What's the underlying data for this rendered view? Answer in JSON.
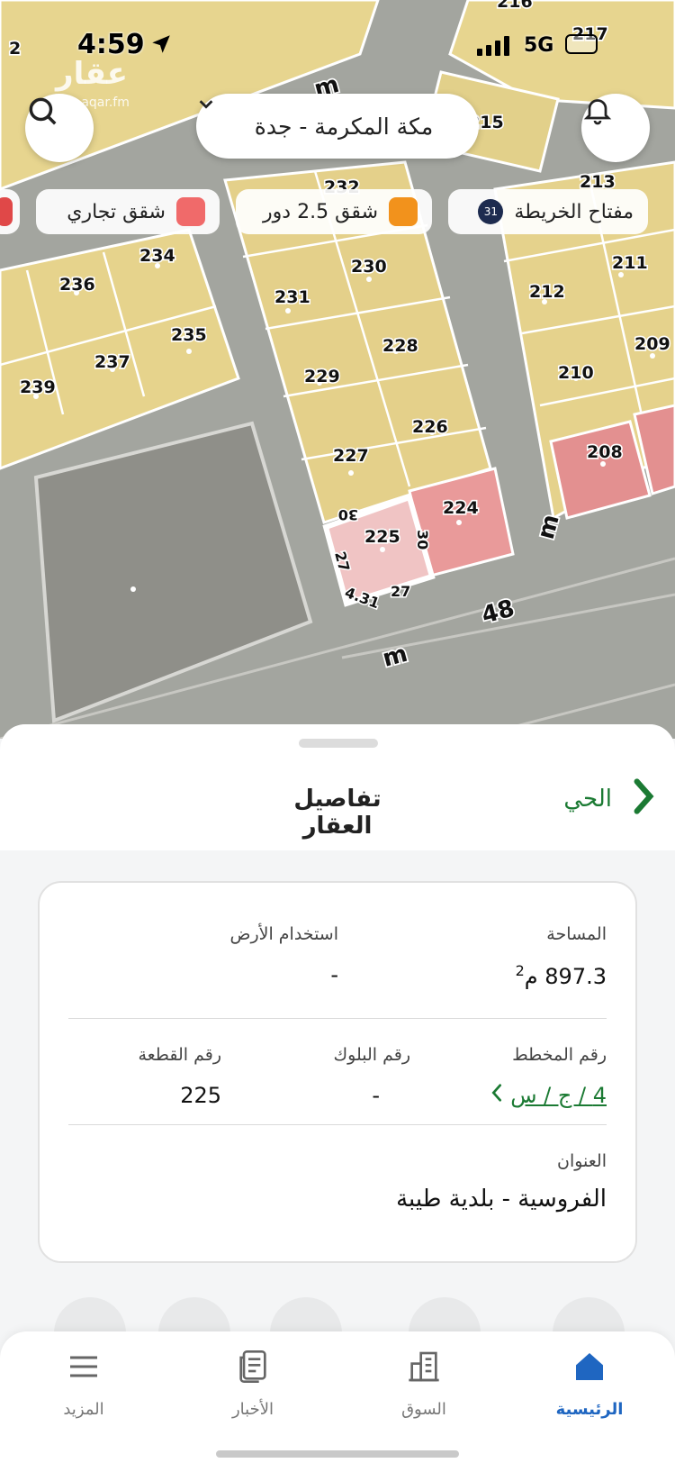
{
  "status_bar": {
    "time": "4:59",
    "network": "5G"
  },
  "watermark": {
    "brand": "عقار",
    "url": "sa.aqar.fm"
  },
  "map": {
    "city_selector": "مكة المكرمة - جدة",
    "legend": {
      "key_label": "مفتاح الخريطة",
      "key_count": "31",
      "apartments_label": "شقق 2.5 دور",
      "apartments_color": "#f2921c",
      "commercial_label": "شقق تجاري",
      "commercial_color": "#f06a6a"
    },
    "plots": {
      "p216": "216",
      "p217": "217",
      "p215": "215",
      "p213": "213",
      "p232": "232",
      "p234": "234",
      "p236": "236",
      "p230": "230",
      "p231": "231",
      "p211": "211",
      "p212": "212",
      "p235": "235",
      "p237": "237",
      "p228": "228",
      "p209": "209",
      "p239": "239",
      "p229": "229",
      "p210": "210",
      "p226": "226",
      "p208": "208",
      "p227": "227",
      "p224": "224",
      "p225": "225",
      "p2": "2"
    },
    "dimensions": {
      "d30a": "30",
      "d30b": "30",
      "d27a": "27",
      "d27b": "27",
      "d431": "4.31"
    },
    "roads": {
      "r1": "m",
      "r2": "m",
      "r3": "m",
      "r48": "48"
    }
  },
  "sheet": {
    "title": "تفاصيل العقار",
    "district_link": "الحي",
    "fields": {
      "area_label": "المساحة",
      "area_value": "897.3",
      "area_unit": "م",
      "area_unit_sup": "2",
      "land_use_label": "استخدام الأرض",
      "land_use_value": "-",
      "plan_label": "رقم المخطط",
      "plan_value": "4 / ج / س",
      "block_label": "رقم البلوك",
      "block_value": "-",
      "plot_label": "رقم القطعة",
      "plot_value": "225",
      "address_label": "العنوان",
      "address_value": "الفروسية - بلدية طيبة"
    }
  },
  "bottom_nav": {
    "home": "الرئيسية",
    "market": "السوق",
    "news": "الأخبار",
    "more": "المزيد",
    "active_color": "#1f66c1"
  }
}
